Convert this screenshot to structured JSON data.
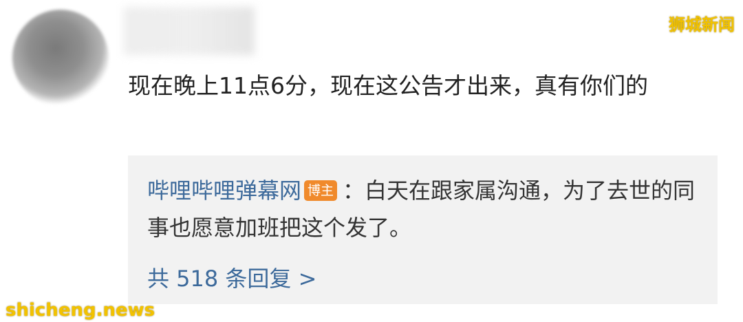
{
  "watermarks": {
    "top": "狮城新闻",
    "bottom": "shicheng.news"
  },
  "comment": {
    "text": "现在晚上11点6分，现在这公告才出来，真有你们的"
  },
  "reply": {
    "author": "哔哩哔哩弹幕网",
    "badge": "博主",
    "separator": "：",
    "text": "白天在跟家属沟通，为了去世的同事也愿意加班把这个发了。",
    "count_label": "共 518 条回复 >"
  },
  "colors": {
    "link": "#3d6a9b",
    "badge": "#f08a2c",
    "watermark": "#f2c200"
  }
}
